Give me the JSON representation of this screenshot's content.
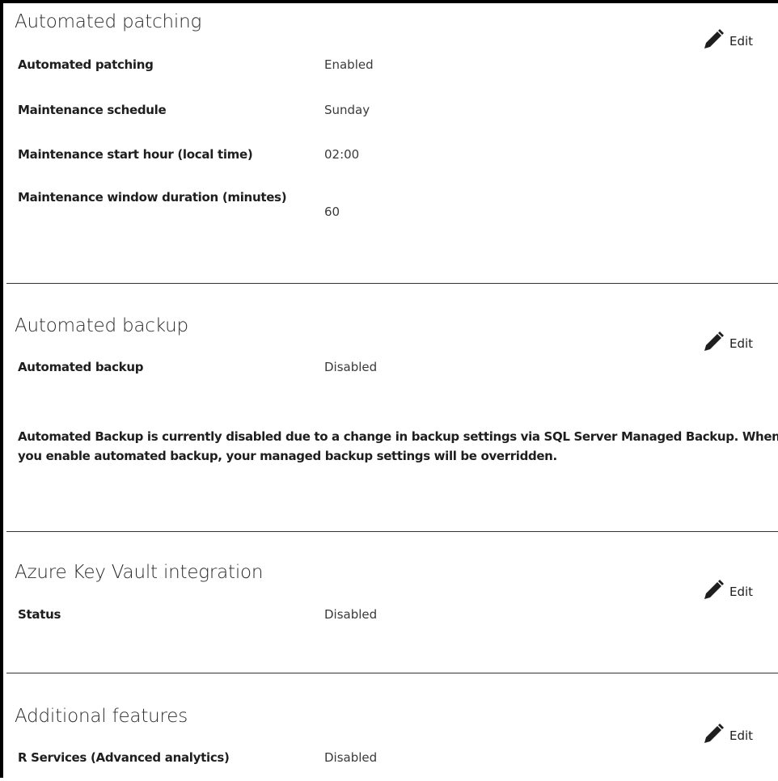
{
  "sections": {
    "patching": {
      "title": "Automated patching",
      "edit_label": "Edit",
      "rows": [
        {
          "label": "Automated patching",
          "value": "Enabled"
        },
        {
          "label": "Maintenance schedule",
          "value": "Sunday"
        },
        {
          "label": "Maintenance start hour (local time)",
          "value": "02:00"
        },
        {
          "label": "Maintenance window duration (minutes)",
          "value": "60"
        }
      ]
    },
    "backup": {
      "title": "Automated backup",
      "edit_label": "Edit",
      "rows": [
        {
          "label": "Automated backup",
          "value": "Disabled"
        }
      ],
      "notice": "Automated Backup is currently disabled due to a change in backup settings via SQL Server Managed Backup. When you enable automated backup, your managed backup settings will be overridden."
    },
    "key_vault": {
      "title": "Azure Key Vault integration",
      "edit_label": "Edit",
      "rows": [
        {
          "label": "Status",
          "value": "Disabled"
        }
      ]
    },
    "additional": {
      "title": "Additional features",
      "edit_label": "Edit",
      "rows": [
        {
          "label": "R Services (Advanced analytics)",
          "value": "Disabled"
        }
      ]
    }
  },
  "icons": {
    "edit": "pencil-icon"
  }
}
